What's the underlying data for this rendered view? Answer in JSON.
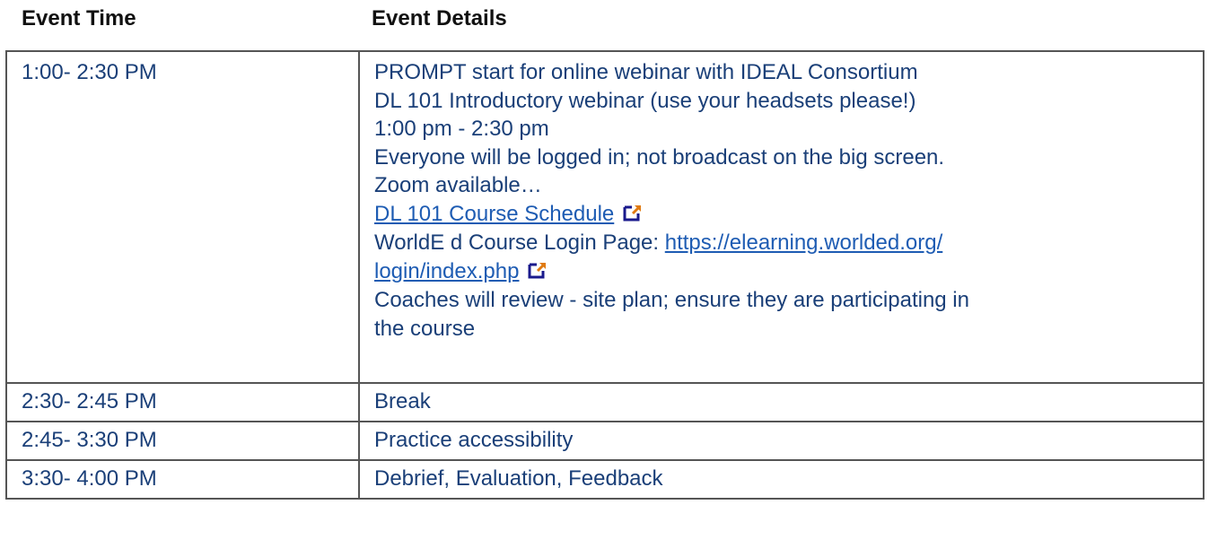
{
  "header": {
    "time_label": "Event Time",
    "details_label": "Event Details"
  },
  "rows": [
    {
      "time": "1:00- 2:30 PM",
      "lines": {
        "l1": "PROMPT start for online webinar with IDEAL Consortium",
        "l2": "DL 101 Introductory webinar (use your headsets please!)",
        "l3": "1:00 pm - 2:30 pm",
        "l4": "Everyone will be logged in; not broadcast on the big screen.",
        "l5": "Zoom available…",
        "schedule_link": "DL 101 Course Schedule",
        "login_prefix": "WorldE d Course Login Page: ",
        "login_link_a": "https://elearning.worlded.org/",
        "login_link_b": "login/index.php",
        "l8a": "Coaches will review - site plan; ensure they are participating in",
        "l8b": "the course"
      }
    },
    {
      "time": "2:30- 2:45 PM",
      "details": "Break"
    },
    {
      "time": "2:45- 3:30 PM",
      "details": "Practice accessibility"
    },
    {
      "time": "3:30- 4:00 PM",
      "details": "Debrief, Evaluation, Feedback"
    }
  ],
  "icons": {
    "external_link": "external-link-icon",
    "accent_color": "#e07a10",
    "frame_color": "#1a1a8c"
  }
}
